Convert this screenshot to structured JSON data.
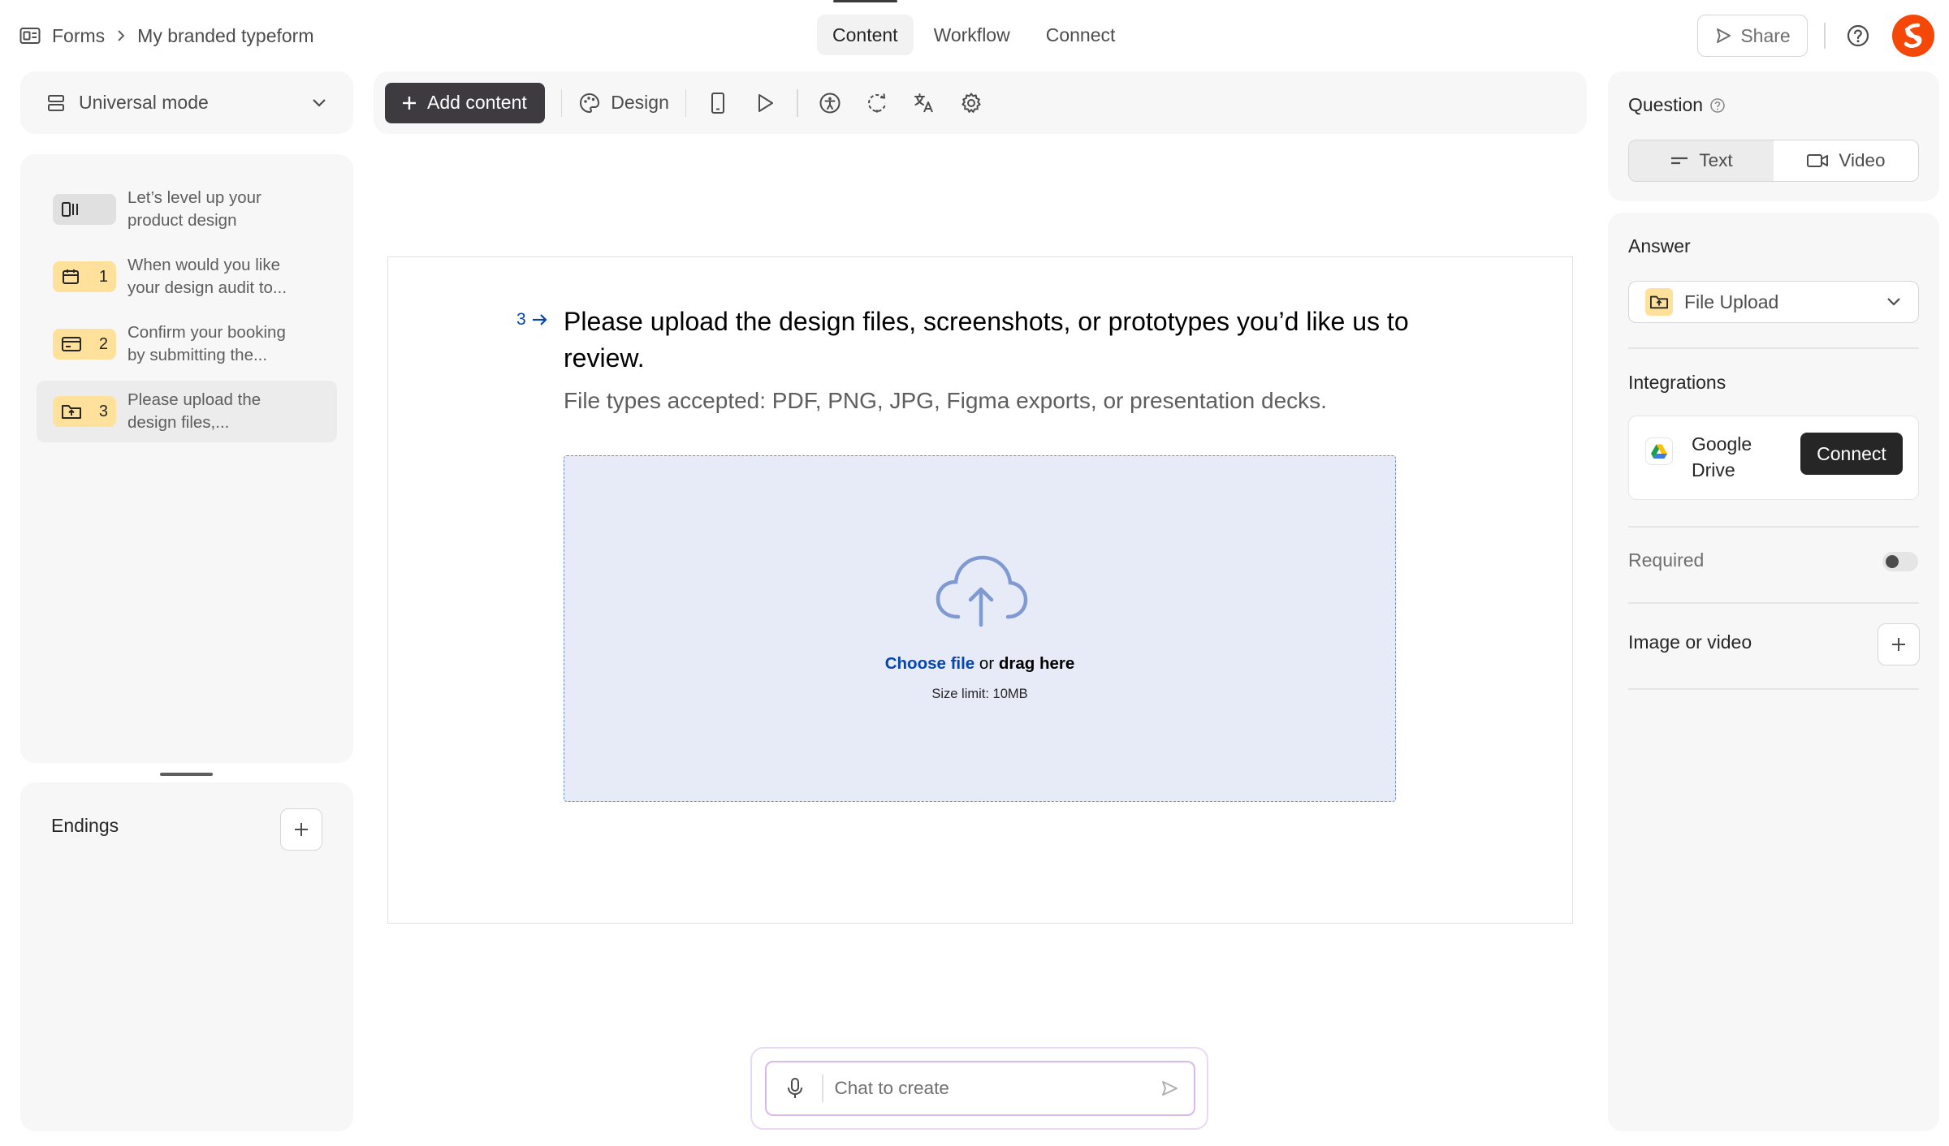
{
  "breadcrumb": {
    "root": "Forms",
    "current": "My branded typeform"
  },
  "tabs": [
    {
      "label": "Content",
      "active": true
    },
    {
      "label": "Workflow",
      "active": false
    },
    {
      "label": "Connect",
      "active": false
    }
  ],
  "header": {
    "share_label": "Share",
    "help_icon": "help-circle-icon",
    "logo_icon": "brand-logo-icon",
    "accent_color": "#f44708"
  },
  "mode_selector": {
    "label": "Universal mode"
  },
  "questions": [
    {
      "number": "",
      "icon": "welcome-screen-icon",
      "text_line1": "Let’s level up your",
      "text_line2": "product design",
      "badge_color": "#e0e0e0"
    },
    {
      "number": "1",
      "icon": "calendar-icon",
      "text_line1": "When would you like",
      "text_line2": "your design audit to...",
      "badge_color": "#ffe19c"
    },
    {
      "number": "2",
      "icon": "payment-card-icon",
      "text_line1": "Confirm your booking",
      "text_line2": "by submitting the...",
      "badge_color": "#ffe19c"
    },
    {
      "number": "3",
      "icon": "file-upload-icon",
      "text_line1": "Please upload the",
      "text_line2": "design files,...",
      "badge_color": "#ffe19c",
      "selected": true
    }
  ],
  "endings": {
    "title": "Endings"
  },
  "toolbar": {
    "add_content_label": "Add content",
    "design_label": "Design",
    "icons": [
      "mobile-preview-icon",
      "play-icon",
      "accessibility-icon",
      "logic-icon",
      "translate-icon",
      "settings-icon"
    ]
  },
  "canvas": {
    "question_number": "3",
    "question_title": "Please upload the design files, screenshots, or prototypes you’d like us to review.",
    "question_description": "File types accepted: PDF, PNG, JPG, Figma exports, or presentation decks.",
    "upload": {
      "choose_label": "Choose file",
      "or_label": " or ",
      "drag_label": "drag here",
      "size_limit": "Size limit: 10MB"
    }
  },
  "chat": {
    "placeholder": "Chat to create"
  },
  "right_panel": {
    "question_title": "Question",
    "question_types": [
      {
        "label": "Text",
        "active": true
      },
      {
        "label": "Video",
        "active": false
      }
    ],
    "answer_title": "Answer",
    "answer_type": "File Upload",
    "integrations_title": "Integrations",
    "integration": {
      "name_line1": "Google",
      "name_line2": "Drive",
      "connect_label": "Connect"
    },
    "required_label": "Required",
    "required_on": false,
    "image_video_label": "Image or video"
  }
}
